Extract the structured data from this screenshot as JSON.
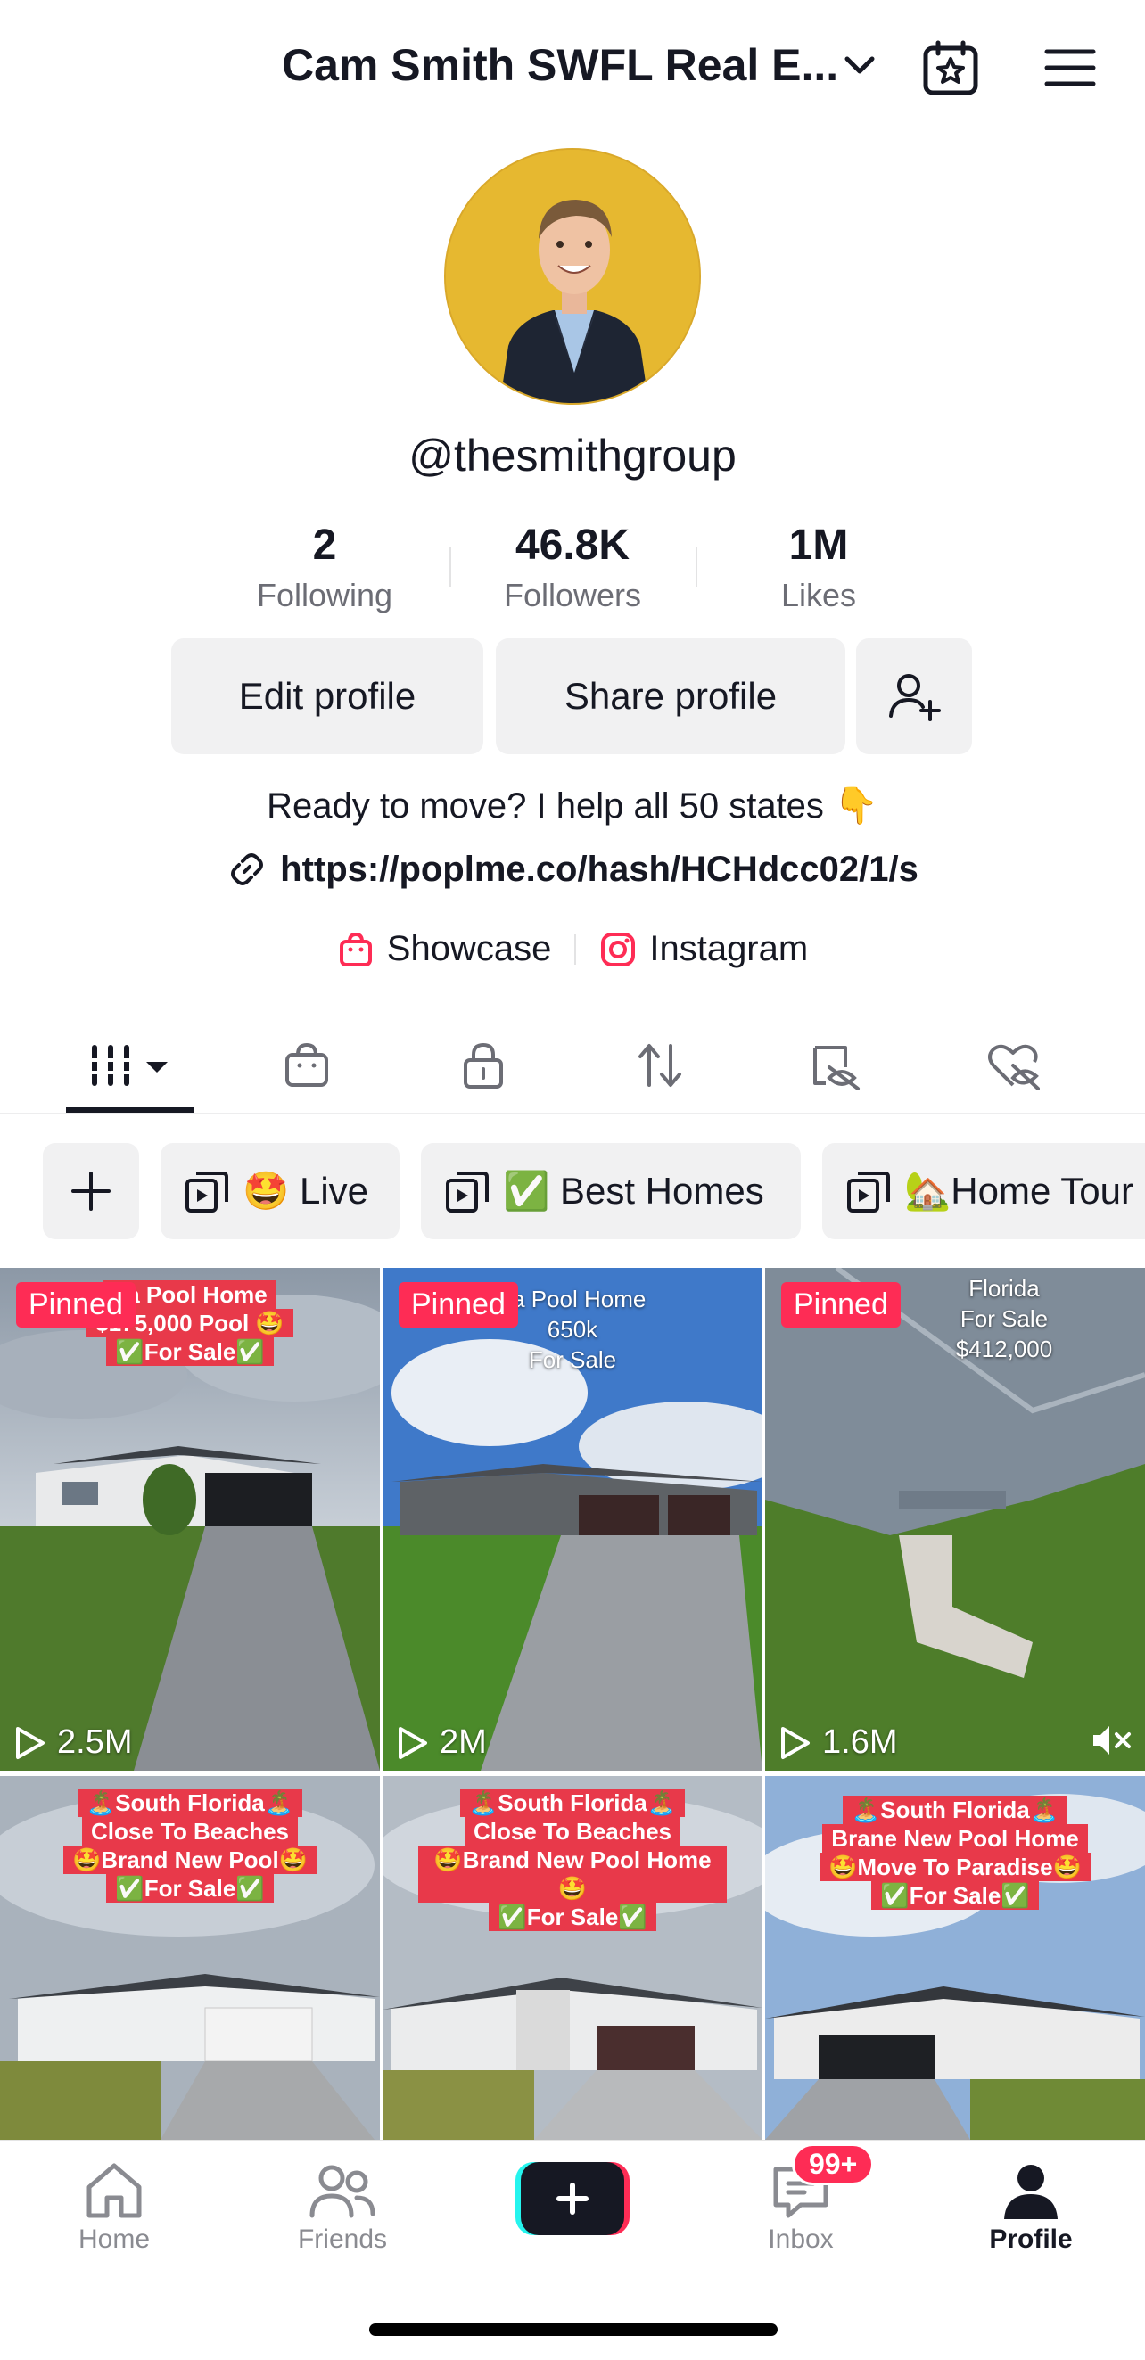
{
  "header": {
    "title": "Cam Smith SWFL Real E...",
    "icons": [
      "chevron-down-icon",
      "calendar-star-icon",
      "menu-icon"
    ]
  },
  "profile": {
    "handle": "@thesmithgroup",
    "stats": [
      {
        "value": "2",
        "label": "Following"
      },
      {
        "value": "46.8K",
        "label": "Followers"
      },
      {
        "value": "1M",
        "label": "Likes"
      }
    ],
    "edit_label": "Edit profile",
    "share_label": "Share profile",
    "bio": "Ready to move? I help all 50 states 👇",
    "link": "https://poplme.co/hash/HCHdcc02/1/s",
    "showcase_label": "Showcase",
    "instagram_label": "Instagram"
  },
  "tabs": [
    "grid-icon",
    "bag-icon",
    "lock-icon",
    "repost-icon",
    "eye-slash-icon",
    "heart-slash-icon"
  ],
  "playlists": [
    {
      "label": "🤩 Live"
    },
    {
      "label": "✅ Best Homes"
    },
    {
      "label": "🏡Home Tour"
    }
  ],
  "videos": [
    {
      "pinned": "Pinned",
      "caption": [
        "da Pool Home",
        "$175,000 Pool 🤩",
        "✅For Sale✅"
      ],
      "views": "2.5M"
    },
    {
      "pinned": "Pinned",
      "caption": [
        "da Pool Home",
        "650k",
        "For Sale"
      ],
      "views": "2M"
    },
    {
      "pinned": "Pinned",
      "caption": [
        "Florida",
        "For Sale",
        "$412,000"
      ],
      "views": "1.6M"
    },
    {
      "caption": [
        "🏝️South Florida🏝️",
        "Close To Beaches",
        "🤩Brand New Pool🤩",
        "✅For Sale✅"
      ]
    },
    {
      "caption": [
        "🏝️South Florida🏝️",
        "Close To Beaches",
        "🤩Brand New Pool Home🤩",
        "✅For Sale✅"
      ]
    },
    {
      "caption": [
        "🏝️South Florida🏝️",
        "Brane New Pool Home",
        "🤩Move To Paradise🤩",
        "✅For Sale✅"
      ]
    }
  ],
  "nav": {
    "home": "Home",
    "friends": "Friends",
    "inbox": "Inbox",
    "inbox_badge": "99+",
    "profile": "Profile"
  },
  "colors": {
    "accent": "#fe2c55",
    "cyan": "#25f4ee",
    "avatar_bg": "#e6b830"
  }
}
